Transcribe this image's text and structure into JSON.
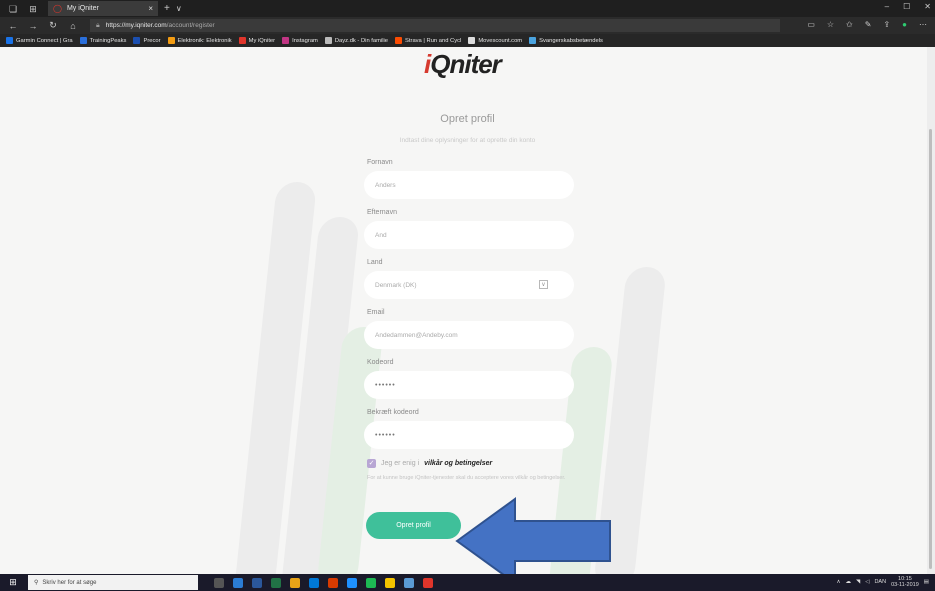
{
  "browser": {
    "tab_title": "My iQniter",
    "tab_close": "×",
    "new_tab": "+",
    "tab_dropdown": "∨",
    "url_host": "https://my.iqniter.com",
    "url_path": "/account/register",
    "window_controls": [
      "–",
      "☐",
      "✕"
    ],
    "bookmarks": [
      {
        "label": "Garmin Connect | Gra",
        "color": "#1a73e8"
      },
      {
        "label": "TrainingPeaks",
        "color": "#2a6fdb"
      },
      {
        "label": "Precor",
        "color": "#1b4fb0"
      },
      {
        "label": "Elektronik: Elektronik",
        "color": "#f39c12"
      },
      {
        "label": "My iQniter",
        "color": "#e0352b"
      },
      {
        "label": "Instagram",
        "color": "#c13584"
      },
      {
        "label": "Dayz.dk - Din familie",
        "color": "#bbbbbb"
      },
      {
        "label": "Strava | Run and Cycl",
        "color": "#fc4c02"
      },
      {
        "label": "Movescount.com",
        "color": "#dddddd"
      },
      {
        "label": "Svangerskabsbetændels",
        "color": "#4aa3df"
      }
    ]
  },
  "page": {
    "logo_text": "Qniter",
    "title": "Opret profil",
    "subtitle": "Indtast dine oplysninger for at oprette din konto",
    "fields": {
      "firstname": {
        "label": "Fornavn",
        "value": "Anders"
      },
      "lastname": {
        "label": "Efternavn",
        "value": "And"
      },
      "country": {
        "label": "Land",
        "value": "Denmark (DK)"
      },
      "email": {
        "label": "Email",
        "value": "Andedammen@Andeby.com"
      },
      "password": {
        "label": "Kodeord",
        "value": "••••••"
      },
      "confirm": {
        "label": "Bekræft kodeord",
        "value": "••••••"
      }
    },
    "terms_prefix": "Jeg er enig i",
    "terms_link": "vilkår og betingelser",
    "terms_note": "For at kunne bruge iQniter-tjenester skal du acceptere vores vilkår og betingelser.",
    "submit_label": "Opret profil"
  },
  "taskbar": {
    "search_placeholder": "Skriv her for at søge",
    "language": "DAN",
    "time": "10:15",
    "date": "03-11-2019"
  }
}
